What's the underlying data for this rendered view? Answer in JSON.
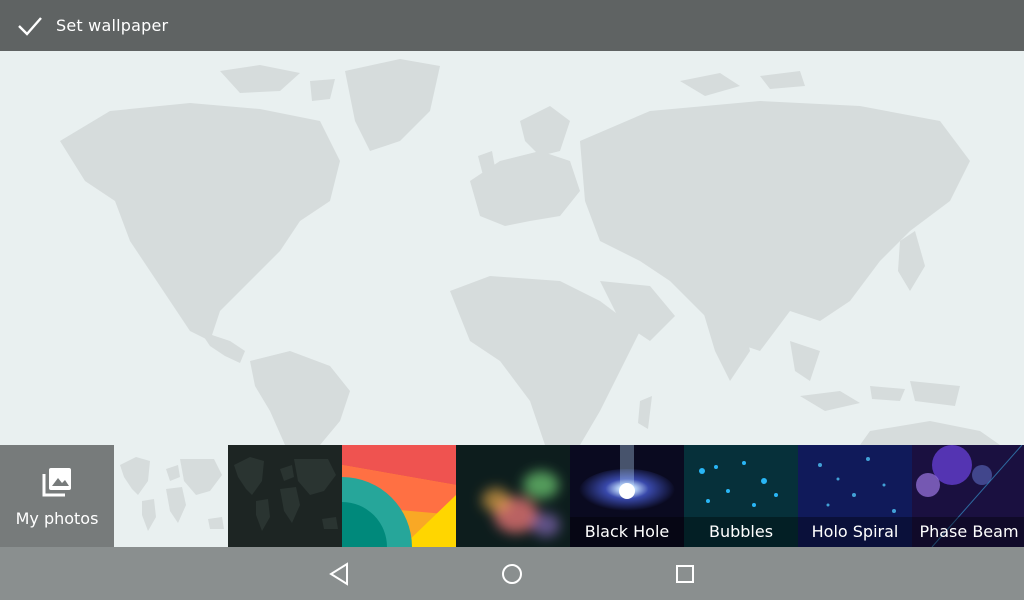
{
  "action_bar": {
    "done_label": "Set wallpaper",
    "icon": "check-icon"
  },
  "picker": {
    "my_photos_label": "My photos",
    "tiles": [
      {
        "label": ""
      },
      {
        "label": ""
      },
      {
        "label": ""
      },
      {
        "label": ""
      },
      {
        "label": "Black Hole"
      },
      {
        "label": "Bubbles"
      },
      {
        "label": "Holo Spiral"
      },
      {
        "label": "Phase Beam"
      }
    ]
  },
  "nav": {
    "back": "back-icon",
    "home": "home-icon",
    "recents": "recents-icon"
  },
  "colors": {
    "action_bar": "#5f6363",
    "nav_bar": "#8a8f8f",
    "map_land": "#d6dcdc",
    "map_sea": "#e9f0f0"
  }
}
